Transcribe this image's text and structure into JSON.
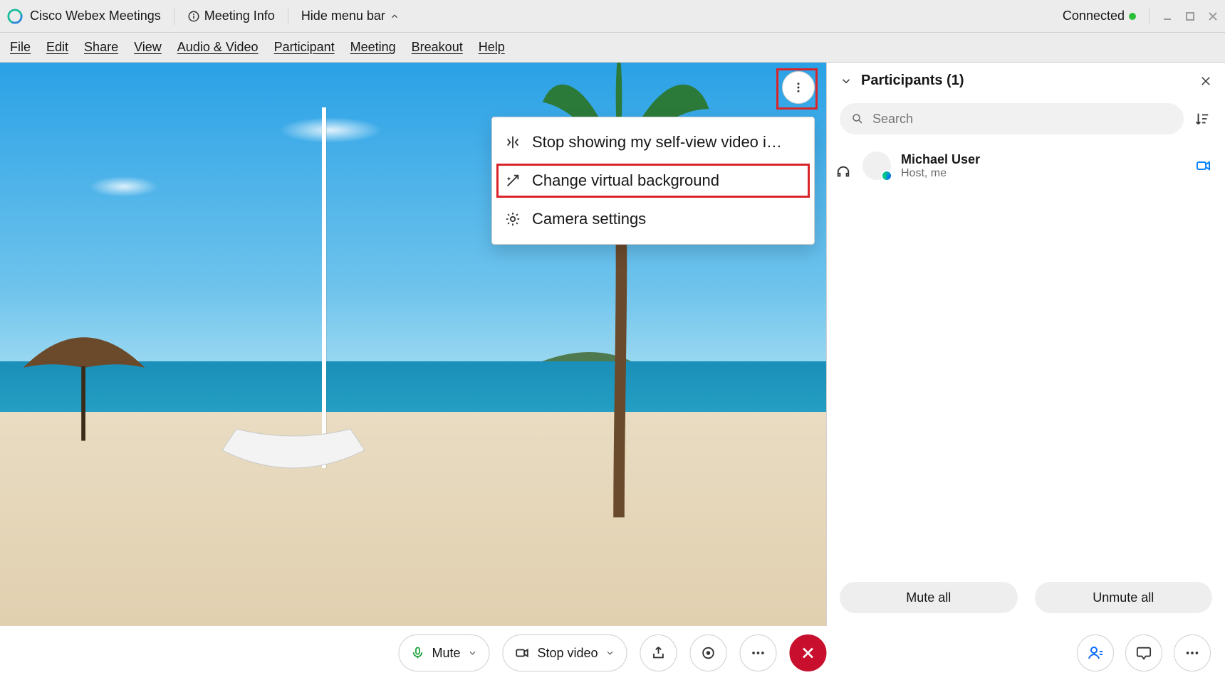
{
  "titlebar": {
    "app_title": "Cisco Webex Meetings",
    "meeting_info": "Meeting Info",
    "hide_menu_bar": "Hide menu bar",
    "connected": "Connected"
  },
  "menu": {
    "file": "File",
    "edit": "Edit",
    "share": "Share",
    "view": "View",
    "audio_video": "Audio & Video",
    "participant": "Participant",
    "meeting": "Meeting",
    "breakout": "Breakout",
    "help": "Help"
  },
  "popover": {
    "item1": "Stop showing my self-view video i…",
    "item2": "Change virtual background",
    "item3": "Camera settings"
  },
  "panel": {
    "title": "Participants (1)",
    "search_placeholder": "Search",
    "participants": [
      {
        "name": "Michael User",
        "role": "Host, me"
      }
    ],
    "mute_all": "Mute all",
    "unmute_all": "Unmute all"
  },
  "toolbar": {
    "mute": "Mute",
    "stop_video": "Stop video"
  }
}
